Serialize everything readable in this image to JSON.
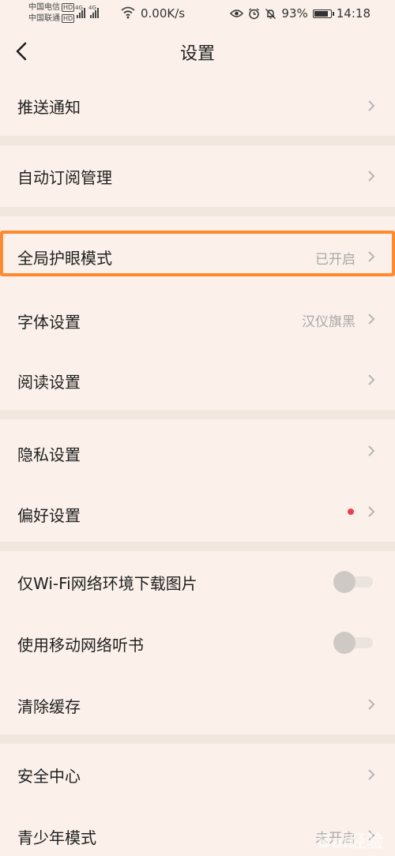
{
  "status_bar": {
    "carrier_1": "中国电信",
    "carrier_2": "中国联通",
    "hd_badge": "HD",
    "network_gen": "4G",
    "net_speed": "0.00K/s",
    "battery": "93%",
    "battery_level": 0.93,
    "time": "14:18"
  },
  "header": {
    "title": "设置"
  },
  "settings": {
    "push": {
      "label": "推送通知"
    },
    "auto_subscribe": {
      "label": "自动订阅管理"
    },
    "eye_care": {
      "label": "全局护眼模式",
      "value": "已开启"
    },
    "font": {
      "label": "字体设置",
      "value": "汉仪旗黑"
    },
    "reading": {
      "label": "阅读设置"
    },
    "privacy": {
      "label": "隐私设置"
    },
    "preferences": {
      "label": "偏好设置"
    },
    "wifi_images": {
      "label": "仅Wi-Fi网络环境下载图片",
      "enabled": false
    },
    "mobile_audio": {
      "label": "使用移动网络听书",
      "enabled": false
    },
    "clear_cache": {
      "label": "清除缓存"
    },
    "security": {
      "label": "安全中心"
    },
    "teen_mode": {
      "label": "青少年模式",
      "value": "未开启"
    }
  },
  "watermark": {
    "text": "Bai经验"
  },
  "colors": {
    "background": "#fbf1ea",
    "separator": "#f2e7df",
    "highlight": "#ff8a2d",
    "badge_dot": "#ee3e4d",
    "secondary_text": "#a8a8a8"
  }
}
